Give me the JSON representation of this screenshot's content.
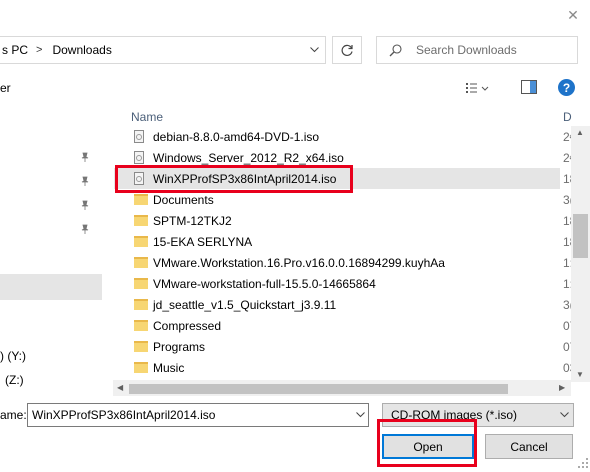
{
  "address": {
    "segments": [
      "s PC",
      "Downloads"
    ],
    "separator": ">"
  },
  "search": {
    "placeholder": "Search Downloads"
  },
  "command_bar": {
    "partial_label": "er"
  },
  "file_list": {
    "column_name": "Name",
    "column_date": "D",
    "rows": [
      {
        "name": "debian-8.8.0-amd64-DVD-1.iso",
        "type": "iso",
        "date": "2€"
      },
      {
        "name": "Windows_Server_2012_R2_x64.iso",
        "type": "iso",
        "date": "2€"
      },
      {
        "name": "WinXPProfSP3x86IntApril2014.iso",
        "type": "iso",
        "date": "18",
        "selected": true
      },
      {
        "name": "Documents",
        "type": "folder",
        "date": "3("
      },
      {
        "name": "SPTM-12TKJ2",
        "type": "folder",
        "date": "18"
      },
      {
        "name": "15-EKA SERLYNA",
        "type": "folder",
        "date": "18"
      },
      {
        "name": "VMware.Workstation.16.Pro.v16.0.0.16894299.kuyhAa",
        "type": "folder",
        "date": "1:"
      },
      {
        "name": "VMware-workstation-full-15.5.0-14665864",
        "type": "folder",
        "date": "1:"
      },
      {
        "name": "jd_seattle_v1.5_Quickstart_j3.9.11",
        "type": "folder",
        "date": "3("
      },
      {
        "name": "Compressed",
        "type": "folder",
        "date": "07"
      },
      {
        "name": "Programs",
        "type": "folder",
        "date": "07"
      },
      {
        "name": "Music",
        "type": "folder",
        "date": "03"
      }
    ]
  },
  "nav": {
    "drives": [
      ") (Y:)",
      "(Z:)"
    ]
  },
  "bottom": {
    "filename_label": "ame:",
    "filename_value": "WinXPProfSP3x86IntApril2014.iso",
    "filetype_value": "CD-ROM images (*.iso)",
    "open_label": "Open",
    "cancel_label": "Cancel"
  },
  "help": {
    "label": "?"
  },
  "colors": {
    "highlight_red": "#e8001c",
    "accent_blue": "#0078d7",
    "selection_gray": "#e5e5e5",
    "folder_yellow": "#f7d673"
  }
}
